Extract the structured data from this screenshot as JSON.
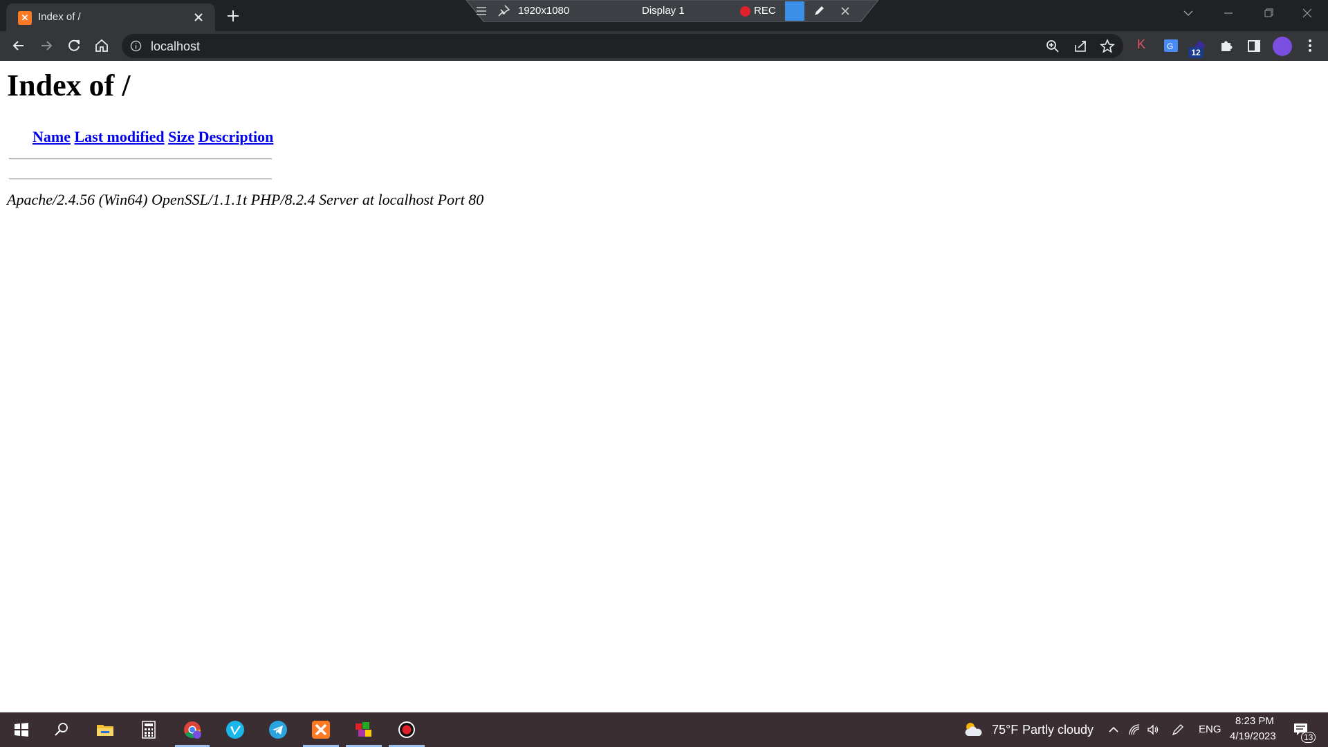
{
  "browser": {
    "tab": {
      "title": "Index of /",
      "favicon": "xampp-icon"
    },
    "url": "localhost",
    "extension_badge": "12",
    "extension_k_label": "K"
  },
  "recorder": {
    "resolution": "1920x1080",
    "display": "Display 1",
    "rec_label": "REC"
  },
  "page": {
    "heading": "Index of /",
    "columns": [
      "Name",
      "Last modified",
      "Size",
      "Description"
    ],
    "address": "Apache/2.4.56 (Win64) OpenSSL/1.1.1t PHP/8.2.4 Server at localhost Port 80"
  },
  "taskbar": {
    "apps": [
      "start-icon",
      "search-icon",
      "file-explorer-icon",
      "calculator-icon",
      "chrome-icon",
      "vimeo-icon",
      "telegram-icon",
      "xampp-icon",
      "winrar-icon",
      "recorder-icon"
    ],
    "weather": {
      "temp": "75°F",
      "condition": "Partly cloudy"
    },
    "language": "ENG",
    "time": "8:23 PM",
    "date": "4/19/2023",
    "notification_count": "13"
  },
  "colors": {
    "link": "#0000ee",
    "chrome_dark": "#202124",
    "chrome_tab": "#35363a",
    "xampp_orange": "#fb7a24"
  }
}
